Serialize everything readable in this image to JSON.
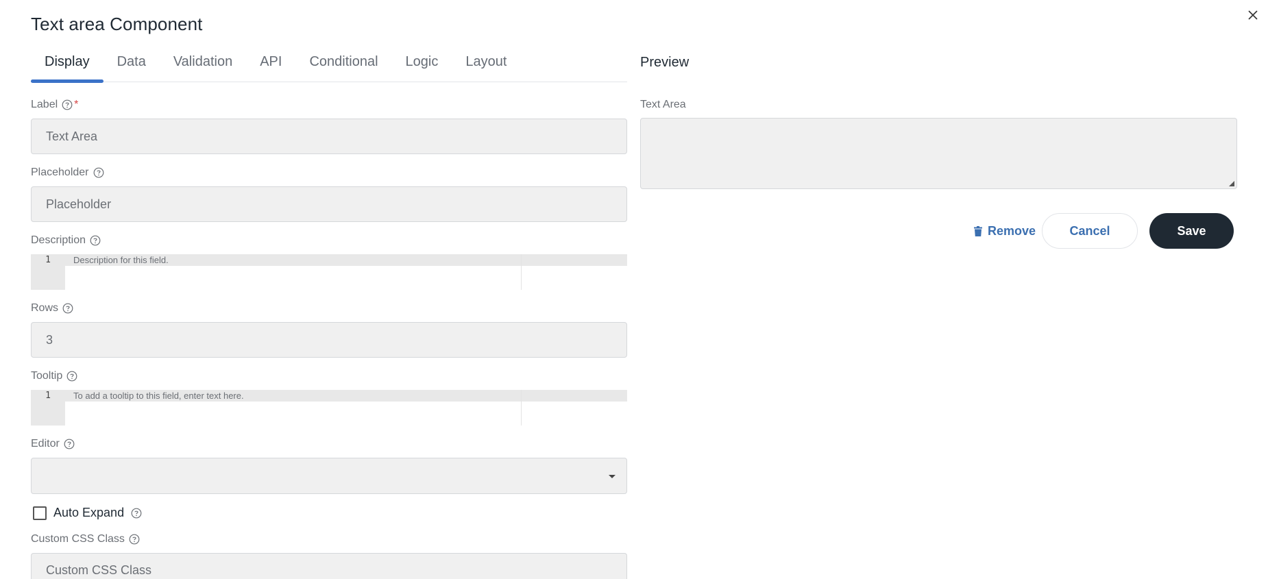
{
  "dialog": {
    "title": "Text area Component",
    "close_icon": "close-icon"
  },
  "tabs": [
    {
      "label": "Display",
      "active": true
    },
    {
      "label": "Data",
      "active": false
    },
    {
      "label": "Validation",
      "active": false
    },
    {
      "label": "API",
      "active": false
    },
    {
      "label": "Conditional",
      "active": false
    },
    {
      "label": "Logic",
      "active": false
    },
    {
      "label": "Layout",
      "active": false
    }
  ],
  "form": {
    "label": {
      "title": "Label",
      "required_marker": "*",
      "value": "Text Area"
    },
    "placeholder": {
      "title": "Placeholder",
      "value": "Placeholder"
    },
    "description": {
      "title": "Description",
      "line_number": "1",
      "text": "Description for this field."
    },
    "rows": {
      "title": "Rows",
      "value": "3"
    },
    "tooltip": {
      "title": "Tooltip",
      "line_number": "1",
      "text": "To add a tooltip to this field, enter text here."
    },
    "editor": {
      "title": "Editor",
      "value": ""
    },
    "auto_expand": {
      "label": "Auto Expand",
      "checked": false
    },
    "custom_css": {
      "title": "Custom CSS Class",
      "value": "Custom CSS Class"
    }
  },
  "preview": {
    "heading": "Preview",
    "field_label": "Text Area"
  },
  "actions": {
    "remove": "Remove",
    "cancel": "Cancel",
    "save": "Save"
  },
  "colors": {
    "accent": "#3b72c8",
    "save_bg": "#1f2933",
    "required": "#d64545"
  }
}
